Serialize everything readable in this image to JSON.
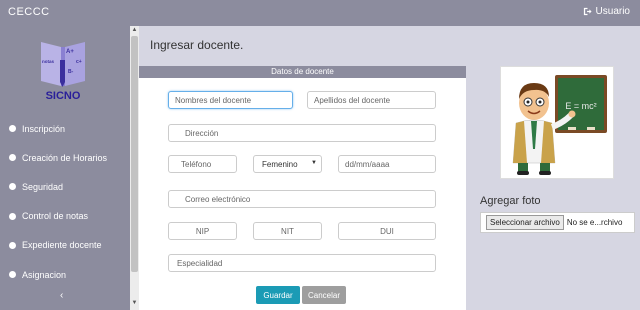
{
  "app": {
    "title": "CECCC",
    "user_label": "Usuario"
  },
  "logo": {
    "letters_top": "A+",
    "letters_left": "notas",
    "letters_right": "c+",
    "letters_mid": "B-",
    "name": "SICNO"
  },
  "sidebar": {
    "items": [
      {
        "label": "Inscripción"
      },
      {
        "label": "Creación de Horarios"
      },
      {
        "label": "Seguridad"
      },
      {
        "label": "Control de notas"
      },
      {
        "label": "Expediente docente"
      },
      {
        "label": "Asignacion"
      }
    ],
    "collapse_glyph": "‹"
  },
  "main": {
    "title": "Ingresar docente.",
    "panel_title": "Datos de docente",
    "form": {
      "nombres_placeholder": "Nombres del docente",
      "apellidos_placeholder": "Apellidos del docente",
      "direccion_placeholder": "Dirección",
      "telefono_placeholder": "Teléfono",
      "genero_value": "Femenino",
      "fecha_placeholder": "dd/mm/aaaa",
      "correo_placeholder": "Correo electrónico",
      "nip_placeholder": "NIP",
      "nit_placeholder": "NIT",
      "dui_placeholder": "DUI",
      "especialidad_placeholder": "Especialidad"
    },
    "buttons": {
      "save": "Guardar",
      "cancel": "Cancelar"
    }
  },
  "right": {
    "board_text": "E = mc²",
    "photo_label": "Agregar foto",
    "file_button": "Seleccionar archivo",
    "file_status": "No se e...rchivo"
  },
  "colors": {
    "bar": "#8c8c9e",
    "primary": "#1b9bb5",
    "secondary": "#9e9e9e",
    "background": "#d6d6e2"
  }
}
